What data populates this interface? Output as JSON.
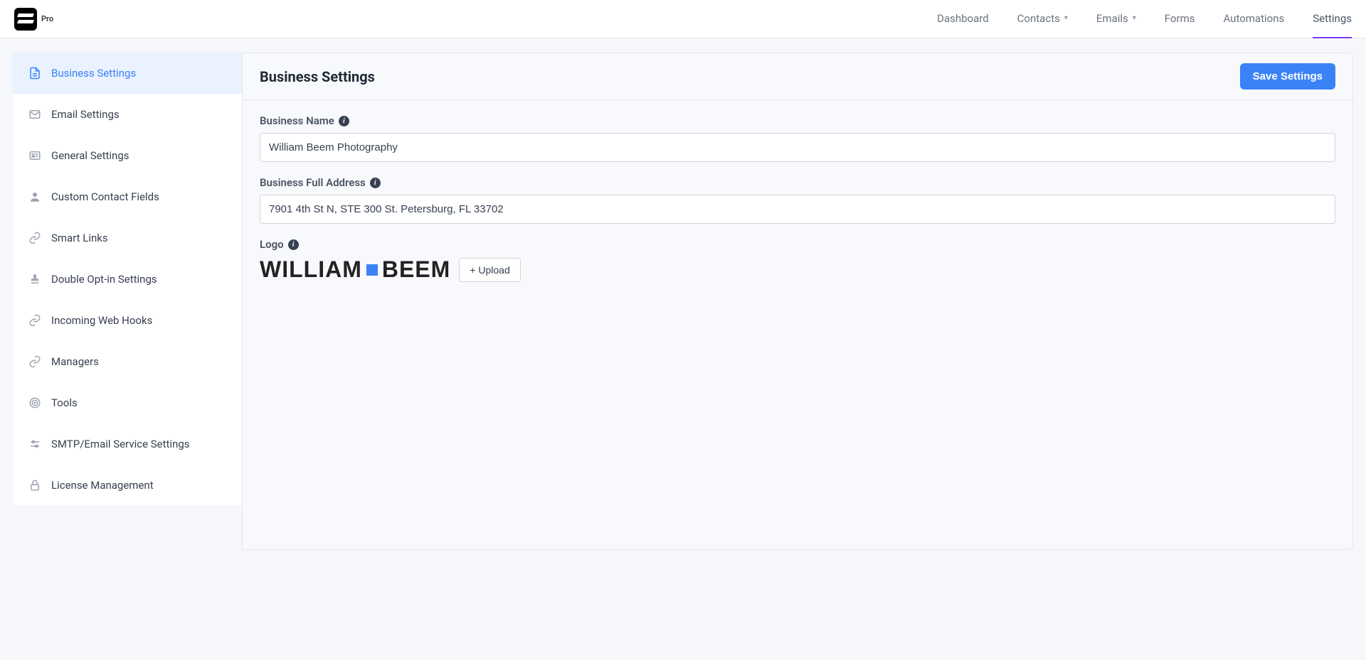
{
  "brand": {
    "badge": "Pro"
  },
  "nav": {
    "dashboard": "Dashboard",
    "contacts": "Contacts",
    "emails": "Emails",
    "forms": "Forms",
    "automations": "Automations",
    "settings": "Settings"
  },
  "sidebar": {
    "items": [
      {
        "label": "Business Settings"
      },
      {
        "label": "Email Settings"
      },
      {
        "label": "General Settings"
      },
      {
        "label": "Custom Contact Fields"
      },
      {
        "label": "Smart Links"
      },
      {
        "label": "Double Opt-in Settings"
      },
      {
        "label": "Incoming Web Hooks"
      },
      {
        "label": "Managers"
      },
      {
        "label": "Tools"
      },
      {
        "label": "SMTP/Email Service Settings"
      },
      {
        "label": "License Management"
      }
    ]
  },
  "page": {
    "title": "Business Settings",
    "save": "Save Settings",
    "fields": {
      "business_name_label": "Business Name",
      "business_name_value": "William Beem Photography",
      "address_label": "Business Full Address",
      "address_value": "7901 4th St N, STE 300 St. Petersburg, FL 33702",
      "logo_label": "Logo",
      "upload": "+ Upload",
      "logo_text_1": "WILLIAM",
      "logo_text_2": "BEEM"
    }
  }
}
